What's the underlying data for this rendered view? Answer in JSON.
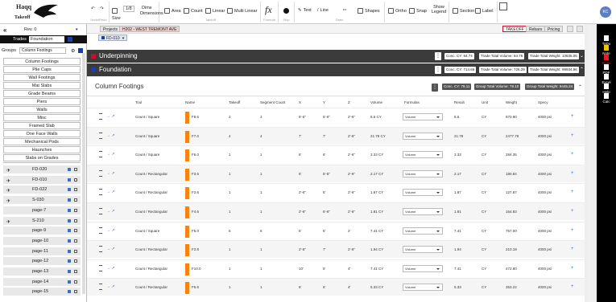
{
  "app": {
    "logo_top": "Haqq",
    "logo_bottom": "Takeoff"
  },
  "toolbar": {
    "undo_redo_caption": "Undo/Redo",
    "size_label": "Size",
    "scale_label": "1/8",
    "dims_label": "Dims",
    "dims_label2": "Dimensions",
    "takeoff_caption": "Takeoff",
    "area": "Area",
    "count": "Count",
    "linear": "Linear",
    "multi_linear": "Multi Linear",
    "formula_caption": "Formula",
    "stop_caption": "Stop",
    "text": "Text",
    "line": "Line",
    "draw_caption": "Draw",
    "shapes": "Shapes",
    "ortho": "Ortho",
    "snap": "Snap",
    "show_legend": "Show Legend",
    "section": "Section",
    "label": "Label",
    "initials": "KC"
  },
  "left": {
    "rev": "Rev. 0",
    "trades_label": "Trades",
    "trades_value": "Foundation",
    "groups_label": "Groups",
    "groups_value": "Column Footings",
    "groups": [
      "Column Footings",
      "Pile Caps",
      "Wall Footings",
      "Mat Slabs",
      "Grade Beams",
      "Piers",
      "Walls",
      "Misc",
      "Framed Slab",
      "One Face Walls",
      "Mechanical Pods",
      "Haunches",
      "Slabs on Grades"
    ],
    "sheets": [
      {
        "name": "FD-020",
        "plane": true
      },
      {
        "name": "FD-010",
        "plane": true
      },
      {
        "name": "FD-022",
        "plane": true
      },
      {
        "name": "S-030",
        "plane": true
      },
      {
        "name": "page-7",
        "plane": false
      },
      {
        "name": "S-210",
        "plane": true
      },
      {
        "name": "page-9",
        "plane": false
      },
      {
        "name": "page-10",
        "plane": false
      },
      {
        "name": "page-11",
        "plane": false
      },
      {
        "name": "page-12",
        "plane": false
      },
      {
        "name": "page-13",
        "plane": false
      },
      {
        "name": "page-14",
        "plane": false
      },
      {
        "name": "page-15",
        "plane": false
      }
    ]
  },
  "tabs": {
    "projects": "Projects",
    "project": "H202 - WEST TREMONT AVE",
    "sheet": "FD-010",
    "takeoff": "TAKEOFF",
    "rebars": "Rebars",
    "pricing": "Pricing"
  },
  "banners": [
    {
      "title": "Underpinning",
      "color": "#c8102e",
      "conc": "Conc. CY: 84.74",
      "trade_vol": "Trade Total Volume: 84.75",
      "trade_wt": "Trade Total Weight: 10835.05"
    },
    {
      "title": "Foundation",
      "color": "#1a3fa8",
      "conc": "Conc. CY: 714.66",
      "trade_vol": "Trade Total Volume: 726.29",
      "trade_wt": "Trade Total Weight: 99934.96"
    }
  ],
  "section": {
    "title": "Column Footings",
    "conc": "Conc. CY: 78.11",
    "group_vol": "Group Total Volume: 78.10",
    "group_wt": "Group Total Weight: 9445.24"
  },
  "table": {
    "headers": [
      "Tool",
      "Name",
      "Takeoff",
      "Segment Count",
      "X",
      "Y",
      "Z",
      "Volume",
      "Formulas",
      "Result",
      "Unit",
      "Weight",
      "Specy"
    ],
    "rows": [
      [
        "Count / Square",
        "F8.6",
        "3",
        "3",
        "5'-6\"",
        "5'-6\"",
        "2'-6\"",
        "8.6 CY",
        "Volume",
        "8.6",
        "CY",
        "870.90",
        "4000 psi"
      ],
      [
        "Count / Square",
        "F7.0",
        "4",
        "4",
        "7'",
        "7'",
        "2'-6\"",
        "21.78 CY",
        "Volume",
        "21.78",
        "CY",
        "2477.78",
        "4000 psi"
      ],
      [
        "Count / Square",
        "F6.0",
        "1",
        "1",
        "6'",
        "6'",
        "2'-6\"",
        "3.33 CY",
        "Volume",
        "3.33",
        "CY",
        "284.35",
        "4000 psi"
      ],
      [
        "Count / Rectangular",
        "F3.6",
        "1",
        "1",
        "5'",
        "5'-6\"",
        "2'-6\"",
        "2.17 CY",
        "Volume",
        "2.17",
        "CY",
        "190.84",
        "4000 psi"
      ],
      [
        "Count / Rectangular",
        "F2.6",
        "1",
        "1",
        "2'-6\"",
        "5'",
        "2'-6\"",
        "1.87 CY",
        "Volume",
        "1.87",
        "CY",
        "127.87",
        "4000 psi"
      ],
      [
        "Count / Rectangular",
        "F4.6",
        "1",
        "1",
        "2'-6\"",
        "6'-6\"",
        "2'-6\"",
        "1.81 CY",
        "Volume",
        "1.81",
        "CY",
        "164.83",
        "4000 psi"
      ],
      [
        "Count / Square",
        "F5.0",
        "6",
        "6",
        "5'",
        "5'",
        "2'",
        "7.41 CY",
        "Volume",
        "7.41",
        "CY",
        "757.00",
        "4000 psi"
      ],
      [
        "Count / Rectangular",
        "F2.8",
        "1",
        "1",
        "2'-6\"",
        "7'",
        "2'-6\"",
        "1.94 CY",
        "Volume",
        "1.94",
        "CY",
        "210.18",
        "4000 psi"
      ],
      [
        "Count / Rectangular",
        "F10.0",
        "1",
        "1",
        "10'",
        "5'",
        "4'",
        "7.41 CY",
        "Volume",
        "7.41",
        "CY",
        "472.80",
        "4000 psi"
      ],
      [
        "Count / Rectangular",
        "F6.6",
        "1",
        "1",
        "6'",
        "6'",
        "4'",
        "5.33 CY",
        "Volume",
        "5.33",
        "CY",
        "353.22",
        "4000 psi"
      ]
    ]
  },
  "rightbar": [
    "ToDo",
    "Note",
    "Draw",
    "PDF",
    "Excel",
    "Help",
    "Calc"
  ]
}
